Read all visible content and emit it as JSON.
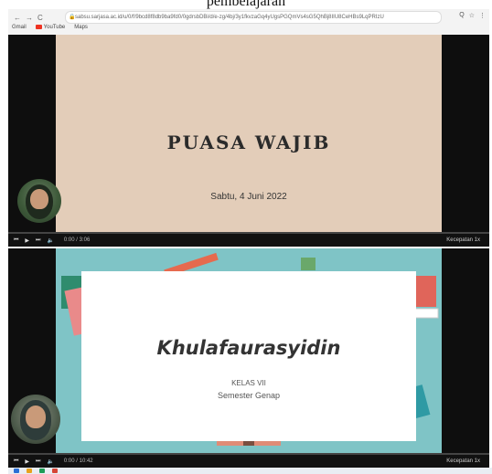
{
  "caption": "pembelajaran",
  "browser": {
    "url": "sabsu.sarjasa.ac.id/u/0/f/9bcd8f8db9ba9fd0/0gdrsbDBi/d/e-zg/4bj/3y1fkvzaGq4yUgsPGQmVs4sG5QhBj8IIU8CeHBs9LqPRIzU",
    "nav_back": "←",
    "nav_forward": "→",
    "nav_reload": "C",
    "bookmarks": [
      "Gmail",
      "YouTube",
      "Maps"
    ],
    "icons": [
      "Q",
      "☆",
      "⋮"
    ]
  },
  "video1": {
    "title": "PUASA WAJIB",
    "date": "Sabtu, 4 Juni 2022",
    "time": "0:00 / 3:06",
    "speed": "Kecepatan 1x",
    "slide_bg": "#e3cdb9",
    "progress": 0.0
  },
  "video2": {
    "title": "Khulafaurasyidin",
    "kelas": "KELAS VII",
    "semester": "Semester Genap",
    "time": "0:00 / 10:42",
    "speed": "Kecepatan 1x",
    "slide_bg": "#7fc4c6",
    "progress": 0.0
  }
}
